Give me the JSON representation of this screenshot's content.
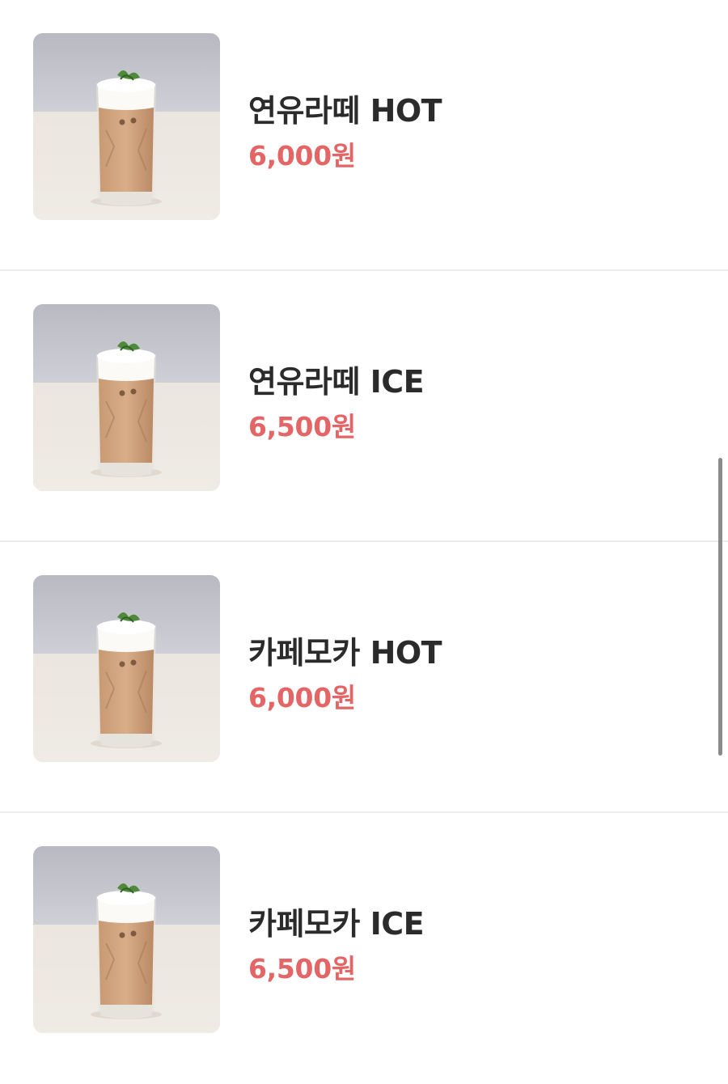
{
  "colors": {
    "name_text": "#2b2b2b",
    "price_text": "#e46565",
    "divider": "#ececec",
    "scrollbar": "#8a8a8a"
  },
  "menu": {
    "items": [
      {
        "name": "연유라떼 HOT",
        "price": "6,000원",
        "image": "iced-latte-glass-photo"
      },
      {
        "name": "연유라떼 ICE",
        "price": "6,500원",
        "image": "iced-latte-glass-photo"
      },
      {
        "name": "카페모카 HOT",
        "price": "6,000원",
        "image": "iced-latte-glass-photo"
      },
      {
        "name": "카페모카 ICE",
        "price": "6,500원",
        "image": "iced-latte-glass-photo"
      }
    ]
  }
}
